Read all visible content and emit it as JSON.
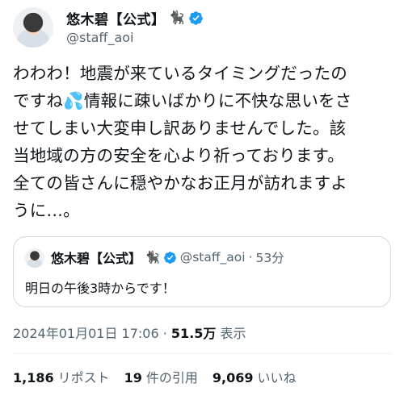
{
  "author": {
    "display_name": "悠木碧【公式】",
    "badge_emoji": "🐈‍⬛",
    "handle": "@staff_aoi",
    "verified_color": "#1d9bf0"
  },
  "tweet": {
    "lines": [
      "わわわ！地震が来ているタイミングだったの",
      "ですね💦情報に疎いばかりに不快な思いをさ",
      "せてしまい大変申し訳ありませんでした。該",
      "当地域の方の安全を心より祈っております。",
      "全ての皆さんに穏やかなお正月が訪れますよ",
      "うに…。"
    ]
  },
  "quote": {
    "display_name": "悠木碧【公式】",
    "badge_emoji": "🐈‍⬛",
    "handle": "@staff_aoi",
    "separator": "·",
    "age": "53分",
    "text": "明日の午後3時からです！"
  },
  "meta": {
    "timestamp": "2024年01月01日 17:06",
    "separator": "·",
    "views_count": "51.5万",
    "views_label": "表示"
  },
  "stats": {
    "reposts_count": "1,186",
    "reposts_label": "リポスト",
    "quotes_count": "19",
    "quotes_label": "件の引用",
    "likes_count": "9,069",
    "likes_label": "いいね"
  }
}
